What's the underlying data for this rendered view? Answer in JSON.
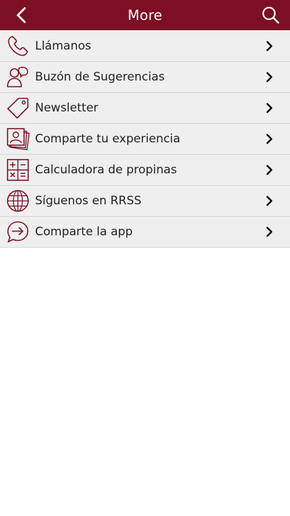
{
  "colors": {
    "brand": "#7d0f24",
    "row_bg": "#efefef",
    "divider": "#d6d6d6",
    "text": "#222222"
  },
  "header": {
    "title": "More",
    "back_icon": "chevron-left-icon",
    "search_icon": "search-icon"
  },
  "menu": {
    "items": [
      {
        "label": "Llámanos",
        "icon": "phone-icon"
      },
      {
        "label": "Buzón de Sugerencias",
        "icon": "users-feedback-icon"
      },
      {
        "label": "Newsletter",
        "icon": "tag-icon"
      },
      {
        "label": "Comparte tu experiencia",
        "icon": "photos-icon"
      },
      {
        "label": "Calculadora de propinas",
        "icon": "calculator-icon"
      },
      {
        "label": "Síguenos en RRSS",
        "icon": "globe-icon"
      },
      {
        "label": "Comparte la app",
        "icon": "share-arrow-icon"
      }
    ]
  }
}
